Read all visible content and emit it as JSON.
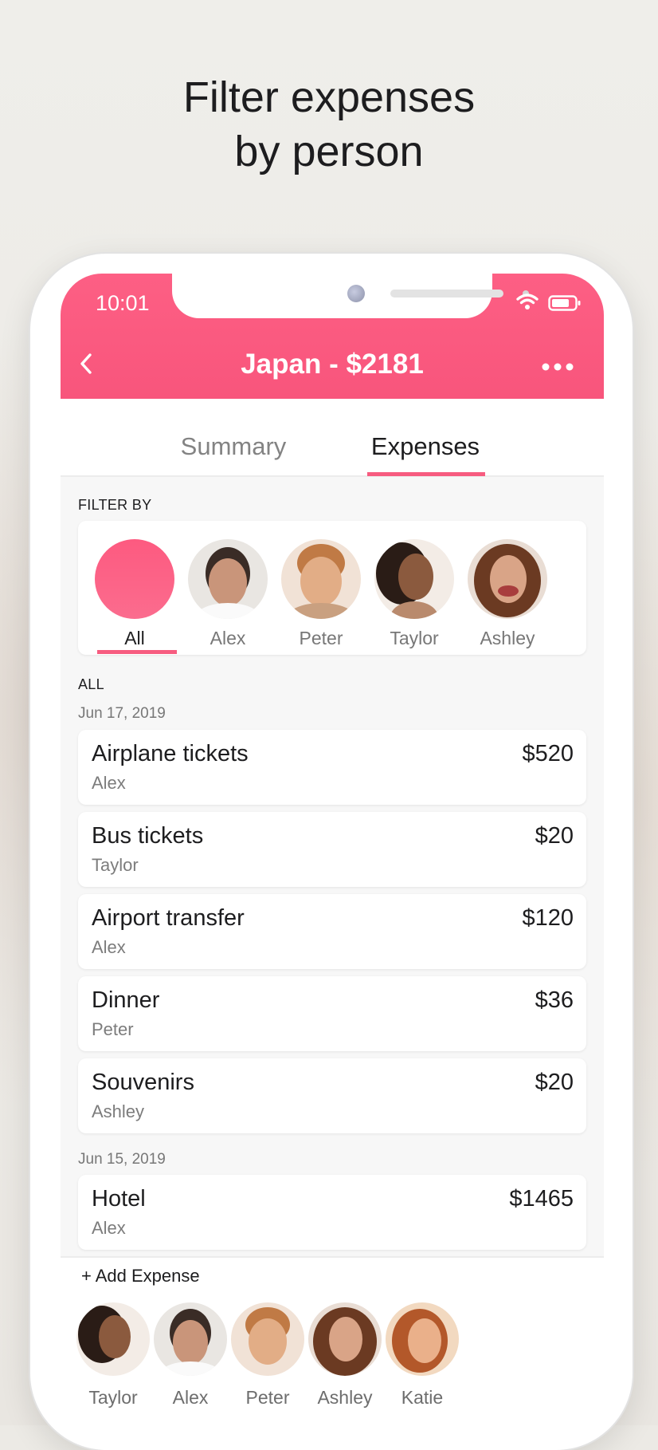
{
  "headline": {
    "line1": "Filter expenses",
    "line2": "by person"
  },
  "status_bar": {
    "time": "10:01"
  },
  "header": {
    "title": "Japan - $2181",
    "accent_color": "#f8557c"
  },
  "tabs": [
    {
      "label": "Summary",
      "active": false
    },
    {
      "label": "Expenses",
      "active": true
    }
  ],
  "filter": {
    "label": "FILTER BY",
    "options": [
      {
        "label": "All",
        "selected": true
      },
      {
        "label": "Alex"
      },
      {
        "label": "Peter"
      },
      {
        "label": "Taylor"
      },
      {
        "label": "Ashley"
      }
    ]
  },
  "list": {
    "section_label": "ALL",
    "groups": [
      {
        "date": "Jun 17, 2019",
        "items": [
          {
            "name": "Airplane tickets",
            "person": "Alex",
            "amount": "$520"
          },
          {
            "name": "Bus tickets",
            "person": "Taylor",
            "amount": "$20"
          },
          {
            "name": "Airport transfer",
            "person": "Alex",
            "amount": "$120"
          },
          {
            "name": "Dinner",
            "person": "Peter",
            "amount": "$36"
          },
          {
            "name": "Souvenirs",
            "person": "Ashley",
            "amount": "$20"
          }
        ]
      },
      {
        "date": "Jun 15, 2019",
        "items": [
          {
            "name": "Hotel",
            "person": "Alex",
            "amount": "$1465"
          }
        ]
      }
    ]
  },
  "add_expense": {
    "label": "+ Add Expense"
  },
  "bottom_people": [
    {
      "label": "Taylor"
    },
    {
      "label": "Alex"
    },
    {
      "label": "Peter"
    },
    {
      "label": "Ashley"
    },
    {
      "label": "Katie"
    }
  ]
}
